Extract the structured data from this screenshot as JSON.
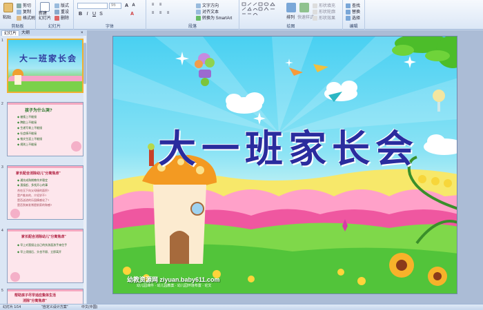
{
  "ribbon": {
    "groups": {
      "clipboard": {
        "label": "剪贴板",
        "paste": "粘贴",
        "cut": "剪切",
        "copy": "复制",
        "format_painter": "格式刷"
      },
      "slides": {
        "label": "幻灯片",
        "new_slide": "新建\n幻灯片",
        "layout": "版式",
        "reset": "重设",
        "delete": "删除"
      },
      "font": {
        "label": "字体",
        "font_size": "96"
      },
      "paragraph": {
        "label": "段落",
        "text_direction": "文字方向",
        "align_text": "对齐文本",
        "smartart": "转换为 SmartArt"
      },
      "drawing": {
        "label": "绘图",
        "arrange": "排列",
        "quick_styles": "快速样式",
        "shape_fill": "形状填充",
        "shape_outline": "形状轮廓",
        "shape_effects": "形状效果"
      },
      "editing": {
        "label": "编辑",
        "find": "查找",
        "replace": "替换",
        "select": "选择"
      }
    }
  },
  "left_pane": {
    "tabs": [
      "幻灯片",
      "大纲"
    ],
    "slides": [
      {
        "num": "1",
        "title": "大一班家长会"
      },
      {
        "num": "2",
        "title": "孩子为什么哭?",
        "lines": [
          "被搂上不能接",
          "脾脏上不能接",
          "生递写育上不能接",
          "社会情不能接",
          "推文生涯上不能接",
          "规则上不能接"
        ]
      },
      {
        "num": "3",
        "title": "家长配合消除幼儿\"分离焦虑\"",
        "lines": [
          "通先成熟期教作并稳定",
          "直接赶、多找开心的事",
          "合在压下向父母接的面积?",
          "是产推本的、介绍学不?",
          "是否送进的乐园情感化了?",
          "是否到来发常提前家的和感?"
        ]
      },
      {
        "num": "4",
        "title": "家长配合消除幼儿\"分离焦虑\"",
        "lines": [
          "早上对直接让自己的扶孩面孩手来住手",
          "早上须接后、头也不顾、立即离开"
        ]
      },
      {
        "num": "5",
        "title": "帮助孩子尽早适应集体生活",
        "subtitle": "消除\"分离焦虑\""
      }
    ]
  },
  "slide": {
    "title": "大一班家长会",
    "watermark": "幼教资源网 ziyuan.baby611.com",
    "watermark_sub": "幼儿园课件 · 幼儿园教案 · 幼儿园环境布置 · 论文"
  },
  "status": {
    "slide_counter": "幻灯片 1/14",
    "theme": "\"自定义设计方案\"",
    "language": "中文(中国)"
  }
}
